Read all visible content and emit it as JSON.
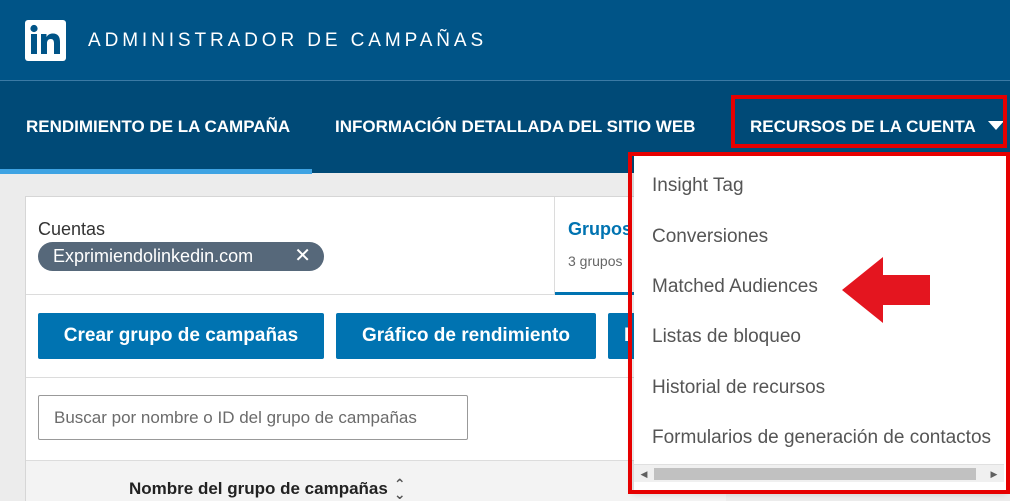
{
  "header": {
    "title": "ADMINISTRADOR DE CAMPAÑAS",
    "logo_text": "in",
    "brand_color": "#005487"
  },
  "nav": {
    "tabs": [
      {
        "label": "RENDIMIENTO DE LA CAMPAÑA",
        "active": true
      },
      {
        "label": "INFORMACIÓN DETALLADA DEL SITIO WEB",
        "active": false
      },
      {
        "label": "RECURSOS DE LA CUENTA",
        "active": false,
        "icon": "caret-down-icon"
      }
    ],
    "active_color": "#3ea3e3"
  },
  "filters": {
    "accounts_label": "Cuentas",
    "account_chip": "Exprimiendolinkedin.com",
    "chip_remove_icon": "close-icon",
    "groups_tab_label": "Grupos",
    "groups_tab_sub": "3 grupos"
  },
  "actions": {
    "create_group": "Crear grupo de campañas",
    "performance_chart": "Gráfico de rendimiento",
    "third_button_partial": "I",
    "button_color": "#0073b1"
  },
  "search": {
    "placeholder": "Buscar por nombre o ID del grupo de campañas"
  },
  "table": {
    "columns": [
      "Nombre del grupo de campañas"
    ],
    "sort_icon": "sort-icon"
  },
  "dropdown": {
    "items": [
      "Insight Tag",
      "Conversiones",
      "Matched Audiences",
      "Listas de bloqueo",
      "Historial de recursos",
      "Formularios de generación de contactos"
    ]
  },
  "annotations": {
    "highlight_color": "#e60000",
    "arrow_icon": "left-arrow-icon"
  }
}
